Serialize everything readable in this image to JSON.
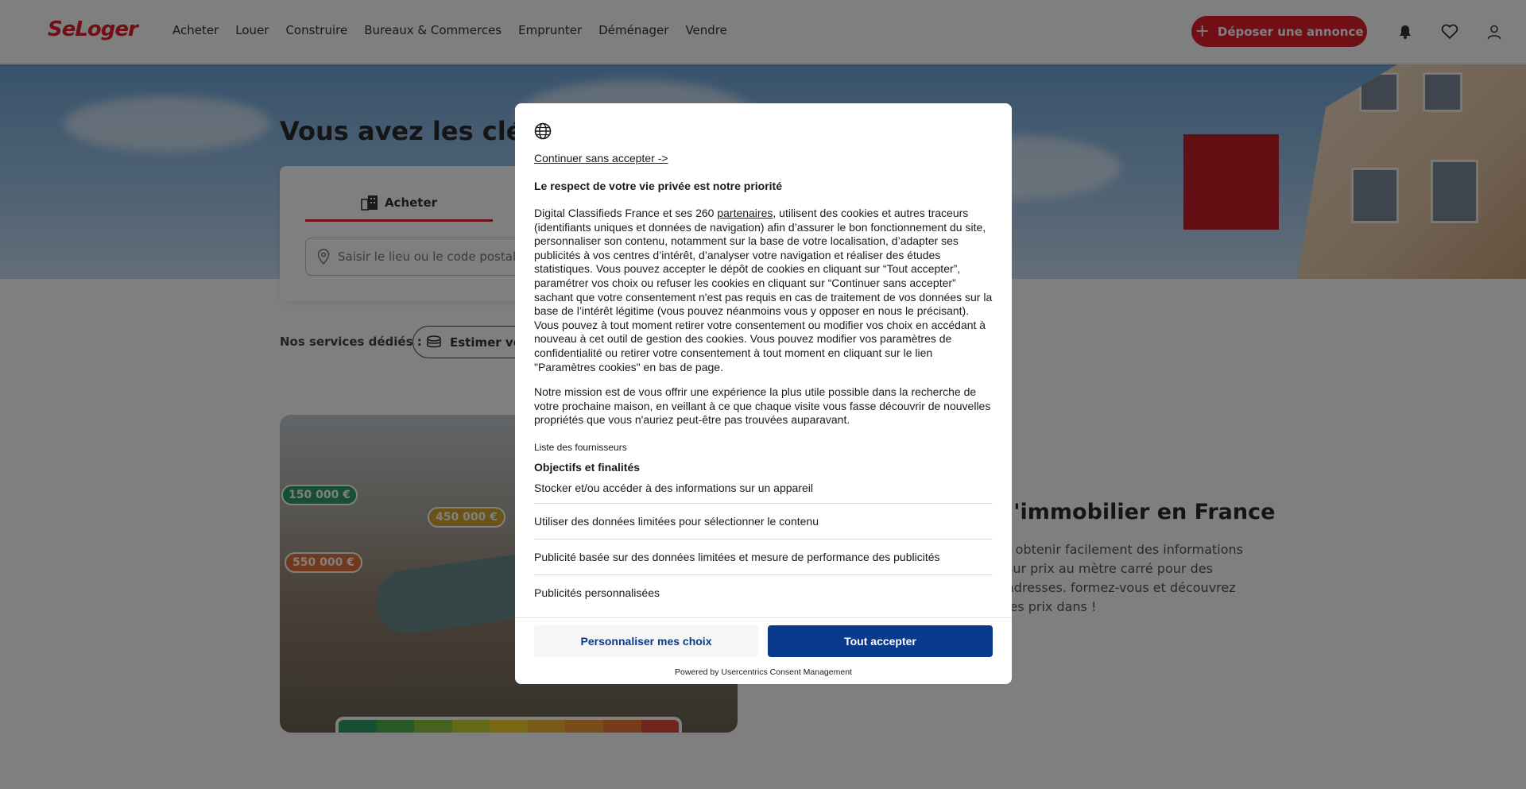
{
  "header": {
    "logo": "SeLoger",
    "nav": [
      "Acheter",
      "Louer",
      "Construire",
      "Bureaux & Commerces",
      "Emprunter",
      "Déménager",
      "Vendre"
    ],
    "post_button": "Déposer une annonce",
    "icons": [
      "bell-icon",
      "heart-icon",
      "user-icon"
    ]
  },
  "hero": {
    "title": "Vous avez les clés !",
    "tab_buy": "Acheter",
    "search_placeholder": "Saisir le lieu ou le code postal"
  },
  "services": {
    "label": "Nos services dédiés :",
    "chip": "Estimer vot"
  },
  "map": {
    "prices": [
      "150 000 €",
      "450 000 €",
      "550 000 €"
    ],
    "colors": {
      "green": "#2e9e6a",
      "gold": "#d4a72c",
      "orange": "#e0703a"
    }
  },
  "right": {
    "title": "l'immobilier en France",
    "text": "r obtenir facilement des informations sur prix au mètre carré pour des adresses. formez-vous et découvrez les prix dans !"
  },
  "consent": {
    "continue_link": "Continuer sans accepter ->",
    "title": "Le respect de votre vie privée est notre priorité",
    "p1_before": "Digital Classifieds France et ses 260 ",
    "p1_link": "partenaires",
    "p1_after": ", utilisent des cookies et autres traceurs (identifiants uniques et données de navigation) afin d’assurer le bon fonctionnement du site, personnaliser son contenu, notamment sur la base de votre localisation, d’adapter ses publicités à vos centres d’intérêt, d’analyser votre navigation et réaliser des études statistiques. Vous pouvez accepter le dépôt de cookies en cliquant sur “Tout accepter”, paramétrer vos choix ou refuser les cookies en cliquant sur “Continuer sans accepter” sachant que votre consentement n'est pas requis en cas de traitement de vos données sur la base de l’intérêt légitime (vous pouvez néanmoins vous y opposer en nous le précisant). Vous pouvez à tout moment retirer votre consentement ou modifier vos choix en accédant à nouveau à cet outil de gestion des cookies. Vous pouvez modifier vos paramètres de confidentialité ou retirer votre consentement à tout moment en cliquant sur le lien \"Paramètres cookies\" en bas de page.",
    "p2": "Notre mission est de vous offrir une expérience la plus utile possible dans la recherche de votre prochaine maison, en veillant à ce que chaque visite vous fasse découvrir de nouvelles propriétés que vous n'auriez peut-être pas trouvées auparavant.",
    "vendors": "Liste des fournisseurs",
    "goals": "Objectifs et finalités",
    "purposes": [
      "Stocker et/ou accéder à des informations sur un appareil",
      "Utiliser des données limitées pour sélectionner le contenu",
      "Publicité basée sur des données limitées et mesure de performance des publicités",
      "Publicités personnalisées"
    ],
    "btn_customize": "Personnaliser mes choix",
    "btn_accept": "Tout accepter",
    "powered": "Powered by Usercentrics Consent Management"
  }
}
